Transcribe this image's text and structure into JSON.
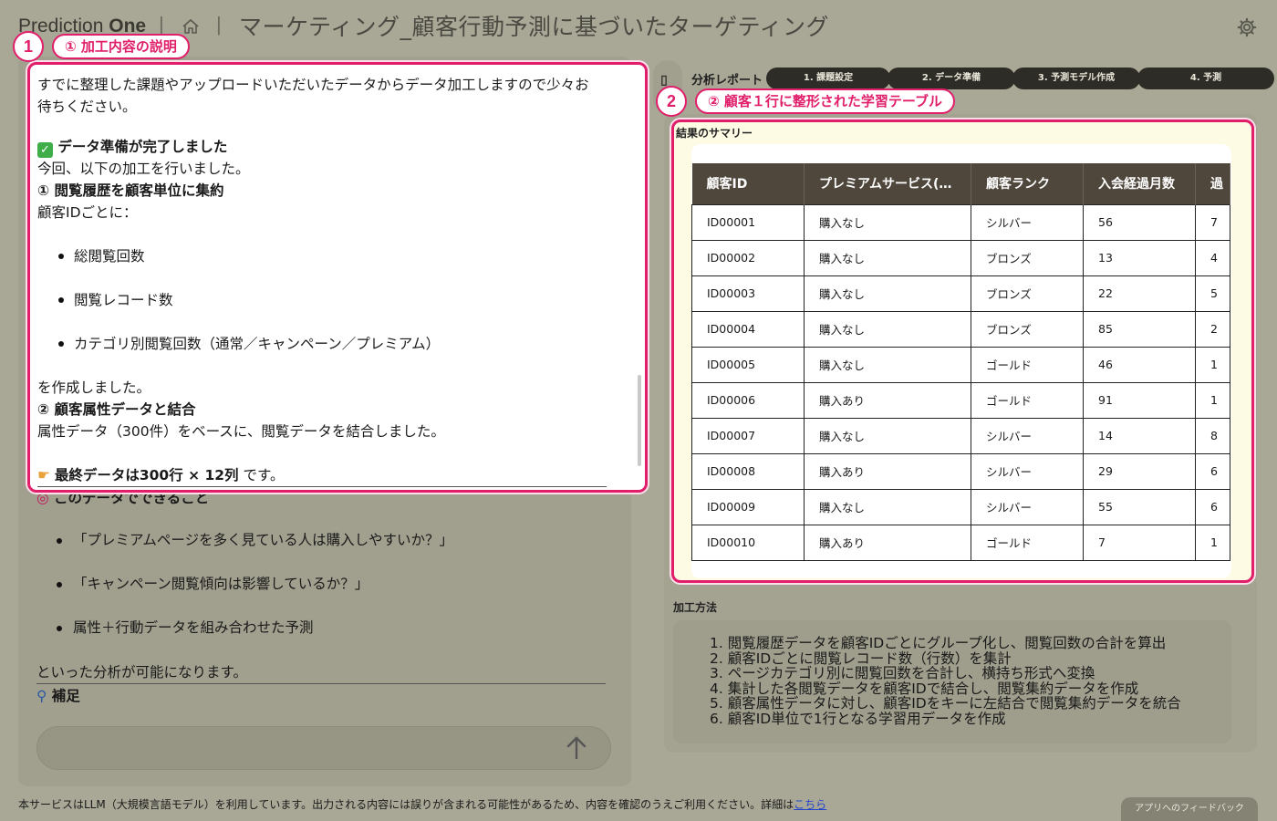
{
  "header": {
    "brand_prefix": "Prediction",
    "brand_suffix": "One",
    "title": "マーケティング_顧客行動予測に基づいたターゲティング"
  },
  "callouts": {
    "one_num": "1",
    "one_label": "① 加工内容の説明",
    "two_num": "2",
    "two_label": "② 顧客１行に整形された学習テーブル"
  },
  "chat": {
    "intro_line1": "すでに整理した課題やアップロードいただいたデータからデータ加工しますので少々お",
    "intro_line2": "待ちください。",
    "done_heading": "データ準備が完了しました",
    "done_sub": "今回、以下の加工を行いました。",
    "step1_heading": "① 閲覧履歴を顧客単位に集約",
    "step1_sub": "顧客IDごとに：",
    "step1_items": [
      "総閲覧回数",
      "閲覧レコード数",
      "カテゴリ別閲覧回数（通常／キャンペーン／プレミアム）"
    ],
    "step1_after": "を作成しました。",
    "step2_heading": "② 顧客属性データと結合",
    "step2_sub": "属性データ（300件）をベースに、閲覧データを結合しました。",
    "final_bold": "最終データは300行 × 12列",
    "final_rest": " です。",
    "can_heading": "このデータでできること",
    "can_items": [
      "「プレミアムページを多く見ている人は購入しやすいか？」",
      "「キャンペーン閲覧傾向は影響しているか？」",
      "属性＋行動データを組み合わせた予測"
    ],
    "can_after": "といった分析が可能になります。",
    "note_heading": "補足"
  },
  "report": {
    "label": "分析レポート",
    "steps": [
      "1. 課題設定",
      "2. データ準備",
      "3. 予測モデル作成",
      "4. 予測"
    ],
    "summary_title": "結果のサマリー",
    "method_title": "加工方法",
    "table": {
      "headers": [
        "顧客ID",
        "プレミアムサービス(…",
        "顧客ランク",
        "入会経過月数",
        "過"
      ],
      "rows": [
        [
          "ID00001",
          "購入なし",
          "シルバー",
          "56",
          "7"
        ],
        [
          "ID00002",
          "購入なし",
          "ブロンズ",
          "13",
          "4"
        ],
        [
          "ID00003",
          "購入なし",
          "ブロンズ",
          "22",
          "5"
        ],
        [
          "ID00004",
          "購入なし",
          "ブロンズ",
          "85",
          "2"
        ],
        [
          "ID00005",
          "購入なし",
          "ゴールド",
          "46",
          "1"
        ],
        [
          "ID00006",
          "購入あり",
          "ゴールド",
          "91",
          "1"
        ],
        [
          "ID00007",
          "購入なし",
          "シルバー",
          "14",
          "8"
        ],
        [
          "ID00008",
          "購入あり",
          "シルバー",
          "29",
          "6"
        ],
        [
          "ID00009",
          "購入なし",
          "シルバー",
          "55",
          "6"
        ],
        [
          "ID00010",
          "購入あり",
          "ゴールド",
          "7",
          "1"
        ]
      ]
    },
    "methods": [
      "1. 閲覧履歴データを顧客IDごとにグループ化し、閲覧回数の合計を算出",
      "2. 顧客IDごとに閲覧レコード数（行数）を集計",
      "3. ページカテゴリ別に閲覧回数を合計し、横持ち形式へ変換",
      "4. 集計した各閲覧データを顧客IDで結合し、閲覧集約データを作成",
      "5. 顧客属性データに対し、顧客IDをキーに左結合で閲覧集約データを統合",
      "6. 顧客ID単位で1行となる学習用データを作成"
    ]
  },
  "footer": {
    "notice": "本サービスはLLM（大規模言語モデル）を利用しています。出力される内容には誤りが含まれる可能性があるため、内容を確認のうえご利用ください。詳細は",
    "link": "こちら",
    "feedback": "アプリへのフィードバック"
  },
  "colors": {
    "background": "#a9a796",
    "accent": "#e01e6a",
    "table_header": "#4f473c",
    "step_pill": "#2e2c26"
  },
  "icons": {
    "home": "home-icon",
    "settings": "gear-icon",
    "send": "arrow-up-icon",
    "done": "check-box-icon",
    "point": "pointing-hand-icon",
    "target": "target-icon",
    "search": "magnifier-icon"
  }
}
